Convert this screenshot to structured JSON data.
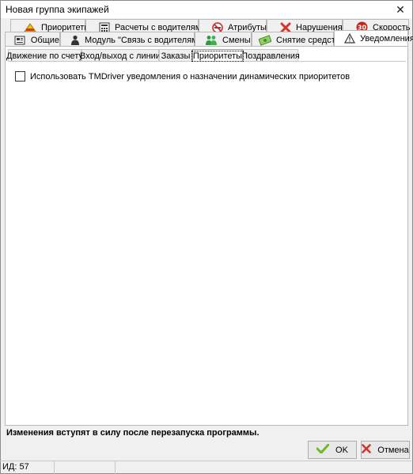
{
  "window": {
    "title": "Новая группа экипажей"
  },
  "tabs_row1": [
    {
      "label": "Приоритеты",
      "icon": "priority-ribbon-icon"
    },
    {
      "label": "Расчеты с водителями",
      "icon": "calculator-icon"
    },
    {
      "label": "Атрибуты",
      "icon": "no-smoking-icon"
    },
    {
      "label": "Нарушения",
      "icon": "red-x-icon"
    },
    {
      "label": "Скорость",
      "icon": "speed-30-icon",
      "badge": "30"
    }
  ],
  "tabs_row2": [
    {
      "label": "Общие",
      "icon": "settings-card-icon"
    },
    {
      "label": "Модуль \"Связь с водителями\"",
      "icon": "driver-icon"
    },
    {
      "label": "Смены",
      "icon": "people-icon"
    },
    {
      "label": "Снятие средств",
      "icon": "money-icon"
    },
    {
      "label": "Уведомления",
      "icon": "warning-icon"
    }
  ],
  "subtabs": [
    {
      "label": "Движение по счету"
    },
    {
      "label": "Вход/выход с линии"
    },
    {
      "label": "Заказы"
    },
    {
      "label": "Приоритеты"
    },
    {
      "label": "Поздравления"
    }
  ],
  "content": {
    "checkbox_label": "Использовать TMDriver уведомления о назначении динамических приоритетов",
    "checkbox_checked": false
  },
  "footer": {
    "notice": "Изменения вступят в силу после перезапуска программы.",
    "ok_label": "OK",
    "cancel_label": "Отмена"
  },
  "statusbar": {
    "id_text": "ИД: 57"
  },
  "colors": {
    "ok_check": "#6fb82a",
    "cancel_x": "#d8322c",
    "speed_badge": "#c0281e"
  }
}
